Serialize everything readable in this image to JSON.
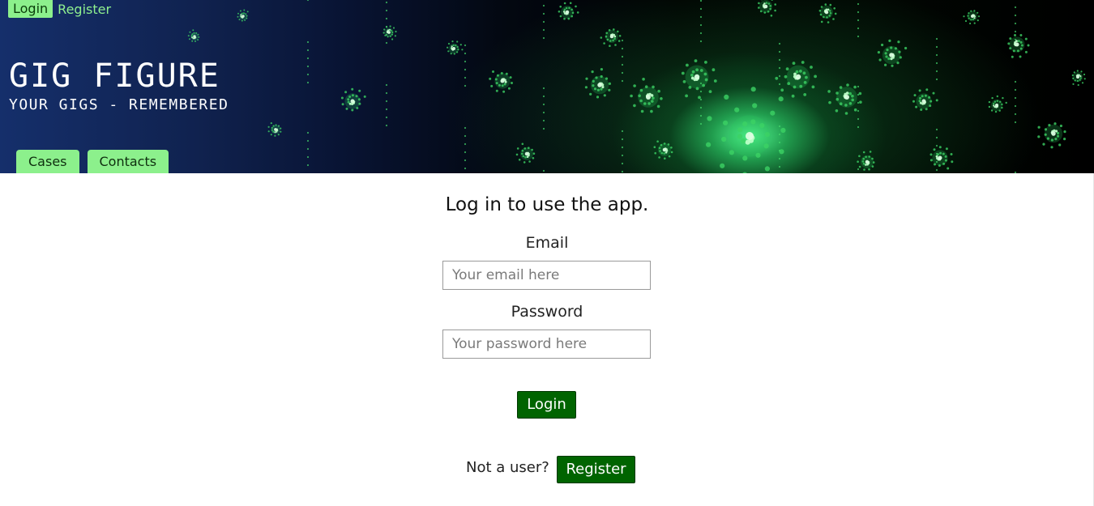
{
  "colors": {
    "accent_tab": "#8cf08c",
    "button_green": "#006400",
    "header_dark": "#000000",
    "header_blue": "#152f6b"
  },
  "header": {
    "auth": {
      "login_label": "Login",
      "register_label": "Register"
    },
    "brand": {
      "title": "GIG FIGURE",
      "subtitle": "YOUR GIGS - REMEMBERED"
    },
    "tabs": [
      {
        "label": "Cases"
      },
      {
        "label": "Contacts"
      }
    ],
    "background_icon": "green-fractal-spiral-image"
  },
  "main": {
    "heading": "Log in to use the app.",
    "email": {
      "label": "Email",
      "placeholder": "Your email here",
      "value": ""
    },
    "password": {
      "label": "Password",
      "placeholder": "Your password here",
      "value": ""
    },
    "login_button": "Login",
    "not_user_text": "Not a user?",
    "register_button": "Register"
  }
}
